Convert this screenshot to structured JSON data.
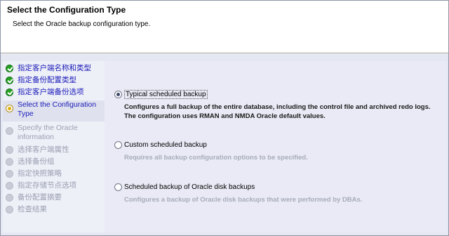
{
  "header": {
    "title": "Select the Configuration Type",
    "description": "Select the Oracle backup configuration type."
  },
  "steps": [
    {
      "label": "指定客户端名称和类型",
      "state": "done"
    },
    {
      "label": "指定备份配置类型",
      "state": "done"
    },
    {
      "label": "指定客户端备份选项",
      "state": "done"
    },
    {
      "label": "Select the Configuration Type",
      "state": "current"
    },
    {
      "label": "Specify the Oracle information",
      "state": "pending"
    },
    {
      "label": "选择客户端属性",
      "state": "pending"
    },
    {
      "label": "选择备份组",
      "state": "pending"
    },
    {
      "label": "指定快照策略",
      "state": "pending"
    },
    {
      "label": "指定存储节点选项",
      "state": "pending"
    },
    {
      "label": "备份配置摘要",
      "state": "pending"
    },
    {
      "label": "检查结果",
      "state": "pending"
    }
  ],
  "options": [
    {
      "label": "Typical scheduled backup",
      "selected": true,
      "description_line1": "Configures a full backup of the entire database, including the control file and archived redo logs.",
      "description_line2": "The configuration uses RMAN and NMDA Oracle default values."
    },
    {
      "label": "Custom scheduled backup",
      "selected": false,
      "description_line1": "Requires all backup configuration options to be specified."
    },
    {
      "label": "Scheduled backup of Oracle disk backups",
      "selected": false,
      "description_line1": "Configures a backup of Oracle disk backups that were performed by DBAs."
    }
  ]
}
